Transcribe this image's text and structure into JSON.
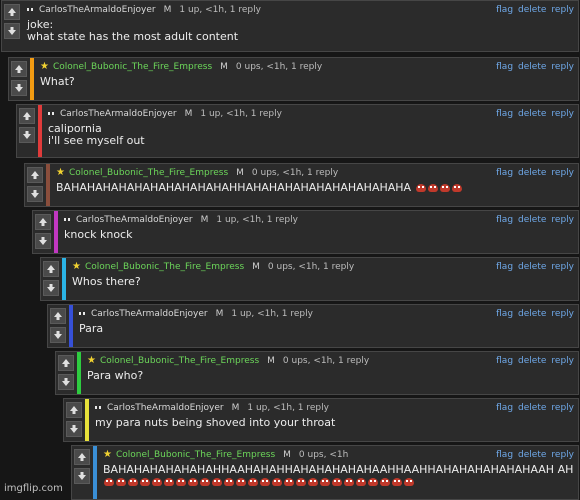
{
  "actions": {
    "flag": "flag",
    "delete": "delete",
    "reply": "reply"
  },
  "comments": [
    {
      "user": "CarlosTheArmaldoEnjoyer",
      "badge": "M",
      "stats": "1 up, <1h, 1 reply",
      "lines": [
        "joke:",
        "what state has the most adult content"
      ]
    },
    {
      "user": "Colonel_Bubonic_The_Fire_Empress",
      "badge": "M",
      "stats": "0 ups, <1h, 1 reply",
      "lines": [
        "What?"
      ]
    },
    {
      "user": "CarlosTheArmaldoEnjoyer",
      "badge": "M",
      "stats": "1 up, <1h, 1 reply",
      "lines": [
        "calipornia",
        "i'll see myself out"
      ]
    },
    {
      "user": "Colonel_Bubonic_The_Fire_Empress",
      "badge": "M",
      "stats": "0 ups, <1h, 1 reply",
      "lines": [
        "BAHAHAHAHAHAHAHAHAHAHAHHAHAHAHAHAHAHAHAHAHAHA"
      ]
    },
    {
      "user": "CarlosTheArmaldoEnjoyer",
      "badge": "M",
      "stats": "1 up, <1h, 1 reply",
      "lines": [
        "knock knock"
      ]
    },
    {
      "user": "Colonel_Bubonic_The_Fire_Empress",
      "badge": "M",
      "stats": "0 ups, <1h, 1 reply",
      "lines": [
        "Whos there?"
      ]
    },
    {
      "user": "CarlosTheArmaldoEnjoyer",
      "badge": "M",
      "stats": "1 up, <1h, 1 reply",
      "lines": [
        "Para"
      ]
    },
    {
      "user": "Colonel_Bubonic_The_Fire_Empress",
      "badge": "M",
      "stats": "0 ups, <1h, 1 reply",
      "lines": [
        "Para who?"
      ]
    },
    {
      "user": "CarlosTheArmaldoEnjoyer",
      "badge": "M",
      "stats": "1 up, <1h, 1 reply",
      "lines": [
        "my para nuts being shoved into your throat"
      ]
    },
    {
      "user": "Colonel_Bubonic_The_Fire_Empress",
      "badge": "M",
      "stats": "0 ups, <1h",
      "lines": [
        "BAHAHAHAHAHAHAHHAAHAHAHHAHAHAHAHAHAAHHAAHHAHAHAHAHAHAHAAH AH"
      ]
    }
  ],
  "watermark": "imgflip.com",
  "colors": {
    "orange": "#f39c12",
    "red": "#e03b3b",
    "brown": "#8a4e3c",
    "magenta": "#c238c2",
    "cyan": "#2bb4e6",
    "blue": "#3650d8",
    "green": "#2ecc40",
    "yellow": "#e8e23a",
    "lightblue": "#3a8fd6"
  },
  "icons": [
    "upvote-arrow-icon",
    "downvote-arrow-icon",
    "user-dots-icon",
    "star-icon",
    "angry-face-emoji-icon"
  ]
}
